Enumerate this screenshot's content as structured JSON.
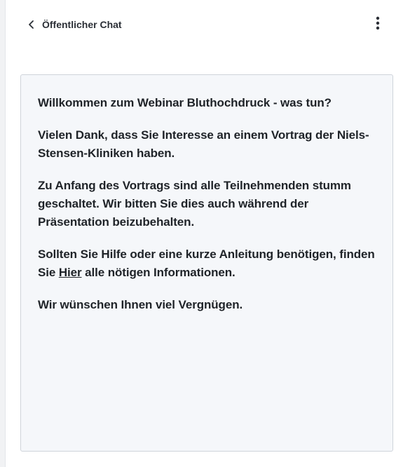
{
  "header": {
    "back_icon": "chevron-left-icon",
    "title": "Öffentlicher Chat",
    "menu_icon": "kebab-menu-icon"
  },
  "welcome": {
    "p1": "Willkommen zum Webinar Bluthochdruck - was tun?",
    "p2": "Vielen Dank, dass Sie Interesse an einem Vortrag der Niels-Stensen-Kliniken haben.",
    "p3": "Zu Anfang des Vortrags sind alle Teilnehmenden stumm geschaltet. Wir bitten Sie dies auch während der Präsentation beizubehalten.",
    "p4_before": "Sollten Sie Hilfe oder eine kurze Anleitung benötigen, finden Sie ",
    "p4_link": "Hier",
    "p4_after": " alle nötigen Informationen.",
    "p5": "Wir wünschen Ihnen viel Vergnügen."
  }
}
